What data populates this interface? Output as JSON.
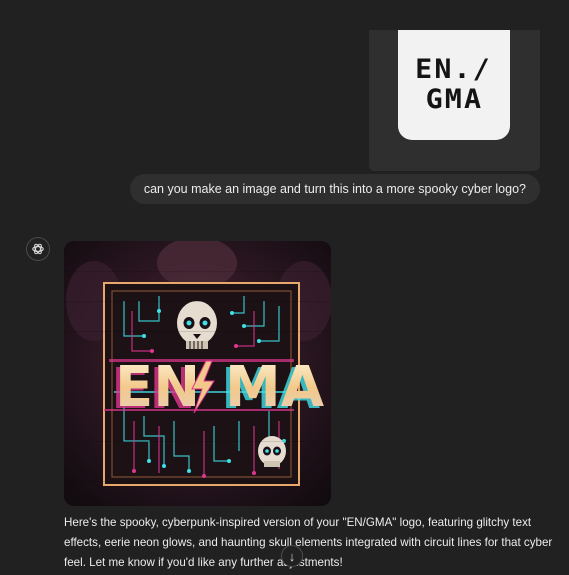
{
  "user_message": {
    "attachment": {
      "logo_line_1": "EN./",
      "logo_line_2": "GMA"
    },
    "text": "can you make an image and turn this into a more spooky cyber logo?"
  },
  "assistant_message": {
    "avatar_icon": "chatgpt-logo-icon",
    "image": {
      "logo_text_left": "EN",
      "logo_text_right": "MA"
    },
    "text": "Here's the spooky, cyberpunk-inspired version of your \"EN/GMA\" logo, featuring glitchy text effects, eerie neon glows, and haunting skull elements integrated with circuit lines for that cyber feel. Let me know if you'd like any further adjustments!"
  },
  "scroll_button": {
    "icon": "arrow-down-icon",
    "glyph": "↓"
  },
  "colors": {
    "background": "#212121",
    "bubble": "#2f2f2f",
    "text": "#ececec",
    "neon_cyan": "#3fe0e6",
    "neon_magenta": "#e0368f",
    "frame_orange": "#e8a86a"
  }
}
